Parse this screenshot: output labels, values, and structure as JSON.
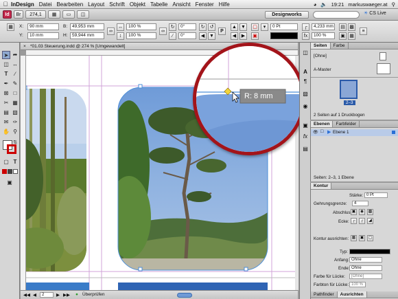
{
  "menubar": {
    "app": "InDesign",
    "items": [
      "Datei",
      "Bearbeiten",
      "Layout",
      "Schrift",
      "Objekt",
      "Tabelle",
      "Ansicht",
      "Fenster",
      "Hilfe"
    ],
    "clock": "19:21",
    "user": "markuswaeger.at"
  },
  "appbar": {
    "zoom": "274,1",
    "workspace": "Designworks",
    "cslive": "CS Live"
  },
  "control": {
    "x_label": "X:",
    "x_value": "90 mm",
    "y_label": "Y:",
    "y_value": "10 mm",
    "b_label": "B:",
    "b_value": "49,953 mm",
    "h_label": "H:",
    "h_value": "59,944 mm",
    "scale_x": "100 %",
    "scale_y": "100 %",
    "angle": "0°",
    "shear": "0°",
    "stroke_weight": "0 Pt",
    "opacity": "100 %",
    "corner": "4,233 mm"
  },
  "document": {
    "tab_title": "*01.03 Steuerung.indd @ 274 % [Umgewandelt]",
    "page_number": "2",
    "preflight": "Überprüfen",
    "tooltip": "R: 8 mm"
  },
  "pages_panel": {
    "tabs": [
      "Seiten",
      "Farbe"
    ],
    "none_label": "[Ohne]",
    "master_label": "A-Master",
    "spread_label": "2–3",
    "footer": "2 Seiten auf 1 Druckbogen"
  },
  "layers_panel": {
    "tabs": [
      "Ebenen",
      "Farbfelder"
    ],
    "layer_name": "Ebene 1",
    "footer": "Seiten: 2–3, 1 Ebene"
  },
  "stroke_panel": {
    "tab": "Kontur",
    "weight_label": "Stärke:",
    "weight_value": "0 Pt",
    "miter_label": "Gehrungsgrenze:",
    "miter_value": "4",
    "cap_label": "Abschluss:",
    "corner_label": "Ecke:",
    "align_label": "Kontur ausrichten:",
    "type_label": "Typ:",
    "start_label": "Anfang:",
    "start_value": "Ohne",
    "end_label": "Ende:",
    "end_value": "Ohne",
    "gap_label": "Farbe für Lücke:",
    "gap_value": "[Ohne]",
    "gap_tint_label": "Farbton für Lücke:",
    "gap_tint_value": "100 %"
  },
  "bottom_tabs": [
    "Pathfinder",
    "Ausrichten"
  ],
  "colors": {
    "selection": "#4d8fd8",
    "callout_ring": "#a3141a",
    "accent": "#2a6fd6"
  }
}
